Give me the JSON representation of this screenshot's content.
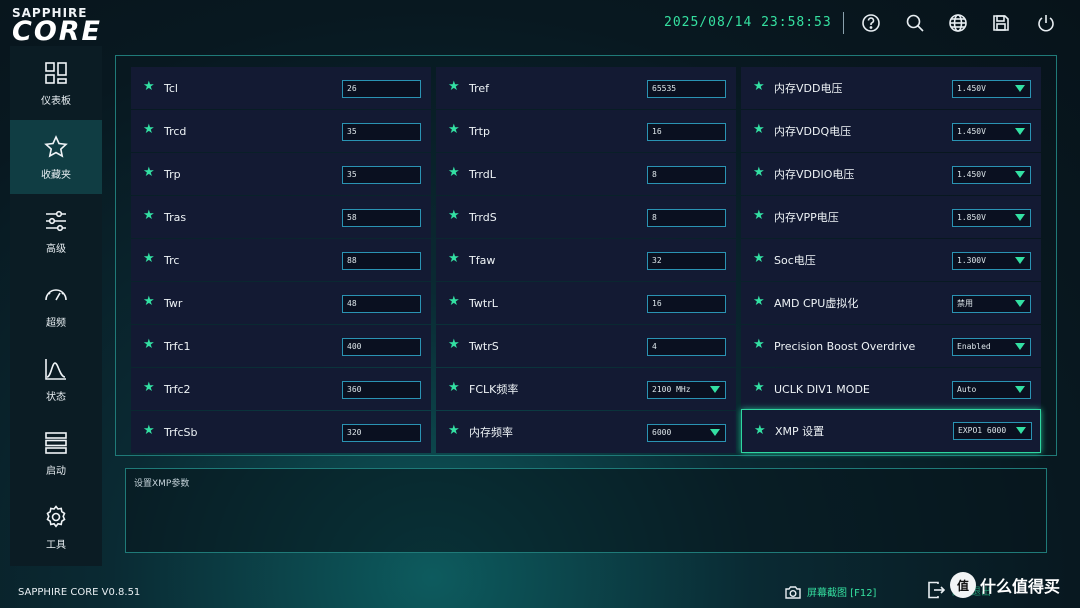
{
  "header": {
    "brand_top": "SAPPHIRE",
    "brand_main": "CORE",
    "datetime": "2025/08/14 23:58:53",
    "icons": [
      "help-icon",
      "search-icon",
      "globe-icon",
      "save-icon",
      "power-icon"
    ]
  },
  "sidebar": {
    "items": [
      {
        "label": "仪表板",
        "icon": "dashboard-icon"
      },
      {
        "label": "收藏夹",
        "icon": "star-icon",
        "active": true
      },
      {
        "label": "高级",
        "icon": "sliders-icon"
      },
      {
        "label": "超频",
        "icon": "gauge-icon"
      },
      {
        "label": "状态",
        "icon": "chart-icon"
      },
      {
        "label": "启动",
        "icon": "boot-icon"
      },
      {
        "label": "工具",
        "icon": "gear-icon"
      }
    ]
  },
  "col1": [
    {
      "label": "Tcl",
      "value": "26"
    },
    {
      "label": "Trcd",
      "value": "35"
    },
    {
      "label": "Trp",
      "value": "35"
    },
    {
      "label": "Tras",
      "value": "58"
    },
    {
      "label": "Trc",
      "value": "88"
    },
    {
      "label": "Twr",
      "value": "48"
    },
    {
      "label": "Trfc1",
      "value": "400"
    },
    {
      "label": "Trfc2",
      "value": "360"
    },
    {
      "label": "TrfcSb",
      "value": "320"
    }
  ],
  "col2": [
    {
      "label": "Tref",
      "value": "65535"
    },
    {
      "label": "Trtp",
      "value": "16"
    },
    {
      "label": "TrrdL",
      "value": "8"
    },
    {
      "label": "TrrdS",
      "value": "8"
    },
    {
      "label": "Tfaw",
      "value": "32"
    },
    {
      "label": "TwtrL",
      "value": "16"
    },
    {
      "label": "TwtrS",
      "value": "4"
    },
    {
      "label": "FCLK频率",
      "value": "2100 MHz"
    },
    {
      "label": "内存频率",
      "value": "6000"
    }
  ],
  "col3": [
    {
      "label": "内存VDD电压",
      "value": "1.450V"
    },
    {
      "label": "内存VDDQ电压",
      "value": "1.450V"
    },
    {
      "label": "内存VDDIO电压",
      "value": "1.450V"
    },
    {
      "label": "内存VPP电压",
      "value": "1.850V"
    },
    {
      "label": "Soc电压",
      "value": "1.300V"
    },
    {
      "label": "AMD CPU虚拟化",
      "value": "禁用"
    },
    {
      "label": "Precision Boost Overdrive",
      "value": "Enabled"
    },
    {
      "label": "UCLK DIV1 MODE",
      "value": "Auto"
    },
    {
      "label": "XMP 设置",
      "value": "EXPO1 6000"
    }
  ],
  "description": "设置XMP参数",
  "footer": {
    "version": "SAPPHIRE CORE V0.8.51",
    "screenshot": "屏幕截图 [F12]",
    "exit": "保存退出",
    "watermark": "什么值得买"
  },
  "colors": {
    "accent": "#33e0a3",
    "cell_bg": "#131a33",
    "border": "#1f7a78"
  }
}
